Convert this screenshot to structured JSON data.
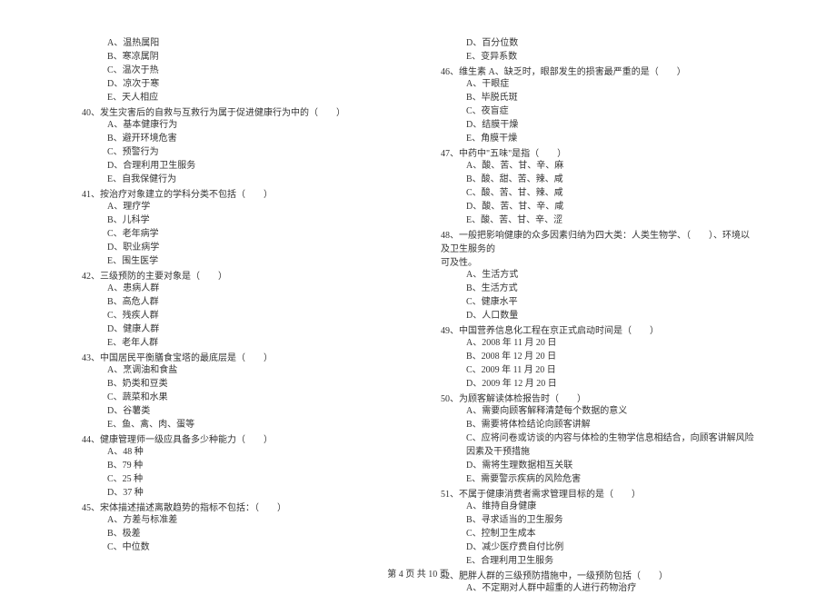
{
  "left_column": [
    {
      "type": "option",
      "text": "A、温热属阳"
    },
    {
      "type": "option",
      "text": "B、寒凉属阴"
    },
    {
      "type": "option",
      "text": "C、温次于热"
    },
    {
      "type": "option",
      "text": "D、凉次于寒"
    },
    {
      "type": "option",
      "text": "E、天人相应"
    },
    {
      "type": "question",
      "text": "40、发生灾害后的自救与互救行为属于促进健康行为中的（　　）"
    },
    {
      "type": "option",
      "text": "A、基本健康行为"
    },
    {
      "type": "option",
      "text": "B、避开环境危害"
    },
    {
      "type": "option",
      "text": "C、预警行为"
    },
    {
      "type": "option",
      "text": "D、合理利用卫生服务"
    },
    {
      "type": "option",
      "text": "E、自我保健行为"
    },
    {
      "type": "question",
      "text": "41、按治疗对象建立的学科分类不包括（　　）"
    },
    {
      "type": "option",
      "text": "A、理疗学"
    },
    {
      "type": "option",
      "text": "B、儿科学"
    },
    {
      "type": "option",
      "text": "C、老年病学"
    },
    {
      "type": "option",
      "text": "D、职业病学"
    },
    {
      "type": "option",
      "text": "E、围生医学"
    },
    {
      "type": "question",
      "text": "42、三级预防的主要对象是（　　）"
    },
    {
      "type": "option",
      "text": "A、患病人群"
    },
    {
      "type": "option",
      "text": "B、高危人群"
    },
    {
      "type": "option",
      "text": "C、残疾人群"
    },
    {
      "type": "option",
      "text": "D、健康人群"
    },
    {
      "type": "option",
      "text": "E、老年人群"
    },
    {
      "type": "spacer"
    },
    {
      "type": "question",
      "text": "43、中国居民平衡膳食宝塔的最底层是（　　）"
    },
    {
      "type": "option",
      "text": "A、烹调油和食盐"
    },
    {
      "type": "option",
      "text": "B、奶类和豆类"
    },
    {
      "type": "option",
      "text": "C、蔬菜和水果"
    },
    {
      "type": "option",
      "text": "D、谷薯类"
    },
    {
      "type": "option",
      "text": "E、鱼、禽、肉、蛋等"
    },
    {
      "type": "question",
      "text": "44、健康管理师一级应具备多少种能力（　　）"
    },
    {
      "type": "option",
      "text": "A、48 种"
    },
    {
      "type": "option",
      "text": "B、79 种"
    },
    {
      "type": "option",
      "text": "C、25 种"
    },
    {
      "type": "option",
      "text": "D、37 种"
    },
    {
      "type": "question",
      "text": "45、宋体描述描述离散趋势的指标不包括：（　　）"
    },
    {
      "type": "option",
      "text": "A、方差与标准差"
    },
    {
      "type": "option",
      "text": "B、极差"
    },
    {
      "type": "option",
      "text": "C、中位数"
    }
  ],
  "right_column": [
    {
      "type": "option",
      "text": "D、百分位数"
    },
    {
      "type": "option",
      "text": "E、变异系数"
    },
    {
      "type": "question",
      "text": "46、维生素 A、缺乏时，眼部发生的损害最严重的是（　　）"
    },
    {
      "type": "option",
      "text": "A、干眼症"
    },
    {
      "type": "option",
      "text": "B、毕脱氏斑"
    },
    {
      "type": "option",
      "text": "C、夜盲症"
    },
    {
      "type": "option",
      "text": "D、结膜干燥"
    },
    {
      "type": "option",
      "text": "E、角膜干燥"
    },
    {
      "type": "question",
      "text": "47、中药中\"五味\"是指（　　）"
    },
    {
      "type": "option",
      "text": "A、酸、苦、甘、辛、麻"
    },
    {
      "type": "option",
      "text": "B、酸、甜、苦、辣、咸"
    },
    {
      "type": "option",
      "text": "C、酸、苦、甘、辣、咸"
    },
    {
      "type": "option",
      "text": "D、酸、苦、甘、辛、咸"
    },
    {
      "type": "option",
      "text": "E、酸、苦、甘、辛、涩"
    },
    {
      "type": "question",
      "text": "48、一般把影响健康的众多因素归纳为四大类：人类生物学、（　　）、环境以及卫生服务的"
    },
    {
      "type": "continuation",
      "text": "可及性。"
    },
    {
      "type": "option",
      "text": "A、生活方式"
    },
    {
      "type": "option",
      "text": "B、生活方式"
    },
    {
      "type": "option",
      "text": "C、健康水平"
    },
    {
      "type": "option",
      "text": "D、人口数量"
    },
    {
      "type": "question",
      "text": "49、中国营养信息化工程在京正式启动时间是（　　）"
    },
    {
      "type": "option",
      "text": "A、2008 年 11 月 20 日"
    },
    {
      "type": "option",
      "text": "B、2008 年 12 月 20 日"
    },
    {
      "type": "option",
      "text": "C、2009 年 11 月 20 日"
    },
    {
      "type": "option",
      "text": "D、2009 年 12 月 20 日"
    },
    {
      "type": "question",
      "text": "50、为顾客解读体检报告时（　　）"
    },
    {
      "type": "option",
      "text": "A、需要向顾客解释清楚每个数据的意义"
    },
    {
      "type": "option",
      "text": "B、需要将体检结论向顾客讲解"
    },
    {
      "type": "option",
      "text": "C、应将问卷或访谈的内容与体检的生物学信息相结合，向顾客讲解风险因素及干预措施"
    },
    {
      "type": "option",
      "text": "D、需将生理数据相互关联"
    },
    {
      "type": "option",
      "text": "E、需要警示疾病的风险危害"
    },
    {
      "type": "question",
      "text": "51、不属于健康消费者需求管理目标的是（　　）"
    },
    {
      "type": "option",
      "text": "A、维持自身健康"
    },
    {
      "type": "option",
      "text": "B、寻求适当的卫生服务"
    },
    {
      "type": "option",
      "text": "C、控制卫生成本"
    },
    {
      "type": "option",
      "text": "D、减少医疗费自付比例"
    },
    {
      "type": "option",
      "text": "E、合理利用卫生服务"
    },
    {
      "type": "question",
      "text": "52、肥胖人群的三级预防措施中，一级预防包括（　　）"
    },
    {
      "type": "option",
      "text": "A、不定期对人群中超重的人进行药物治疗"
    }
  ],
  "footer": "第 4 页 共 10 页"
}
